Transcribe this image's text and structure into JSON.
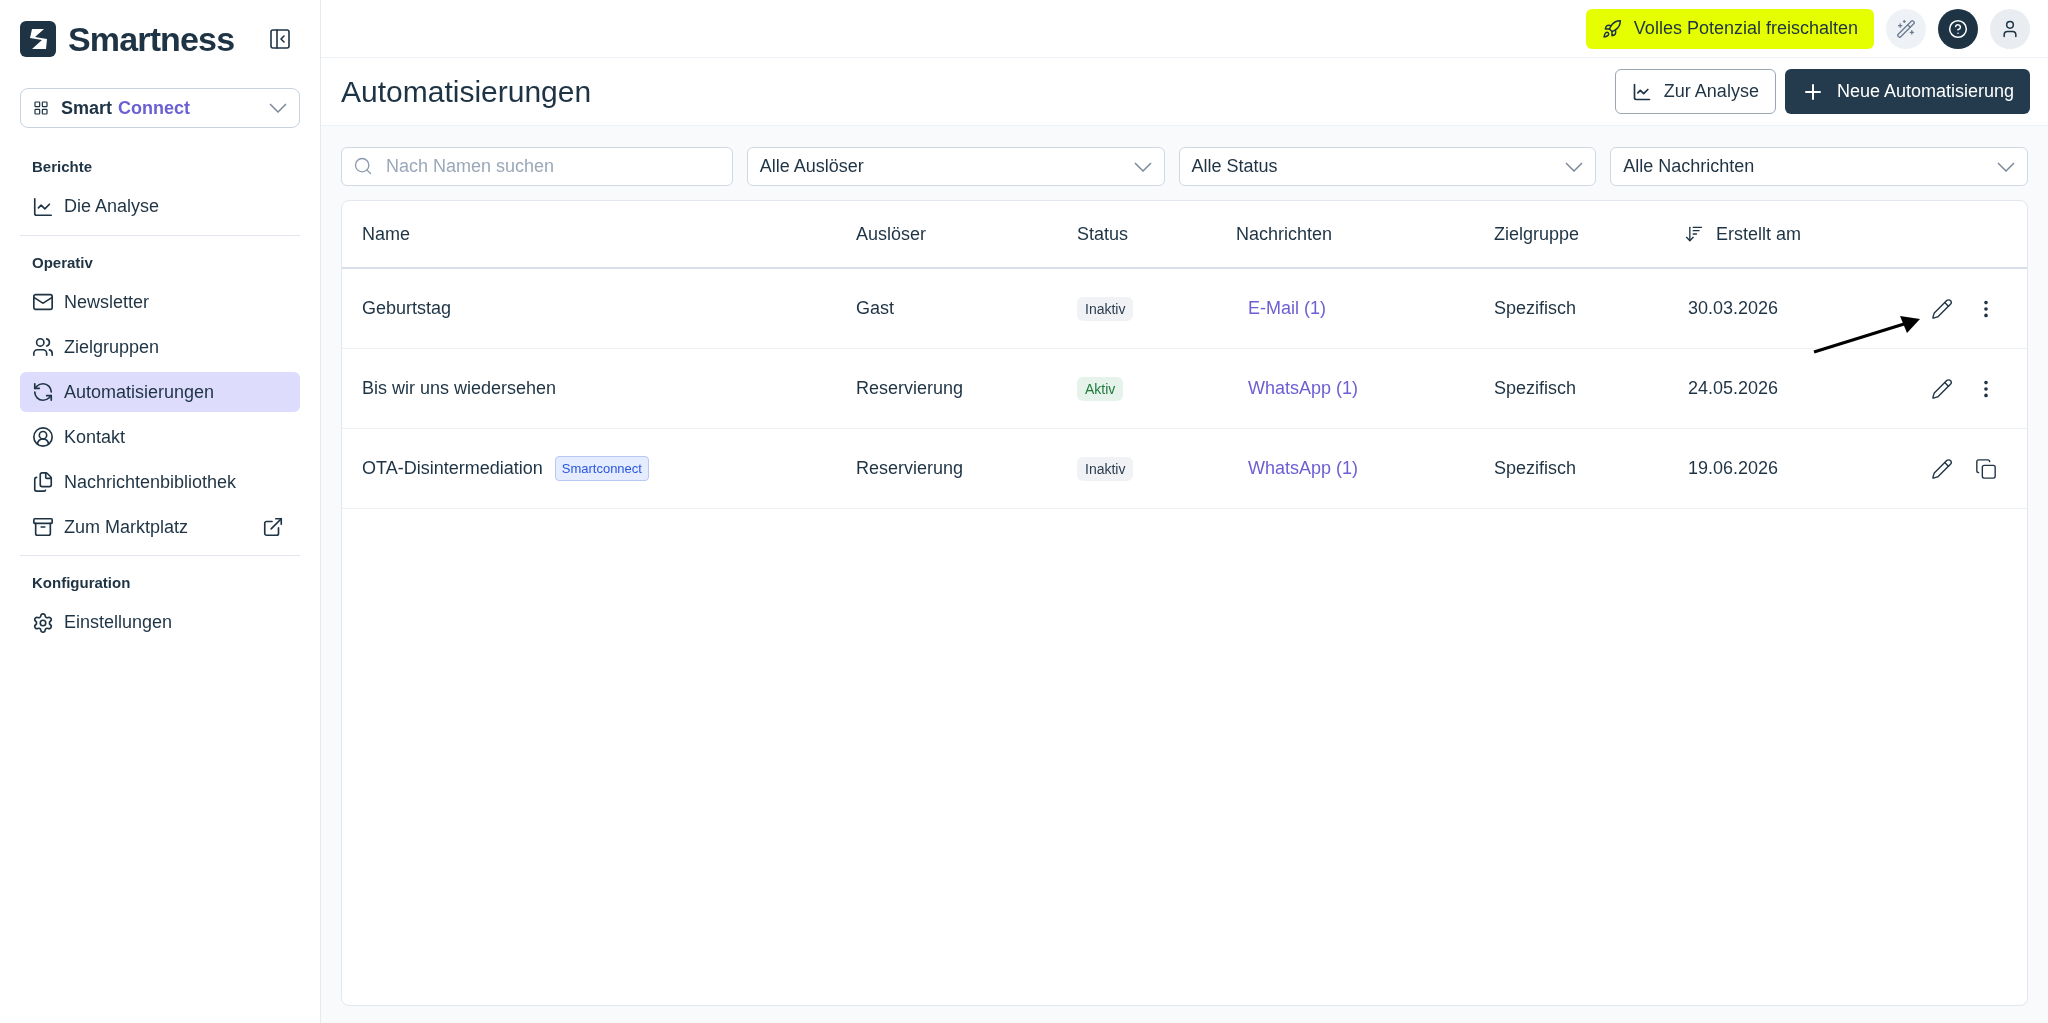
{
  "brand": {
    "name": "Smartness"
  },
  "product_switcher": {
    "label_bold": "Smart",
    "label_accent": "Connect"
  },
  "sidebar": {
    "sections": [
      {
        "title": "Berichte",
        "items": [
          {
            "label": "Die Analyse",
            "selected": false
          }
        ]
      },
      {
        "title": "Operativ",
        "items": [
          {
            "label": "Newsletter",
            "selected": false
          },
          {
            "label": "Zielgruppen",
            "selected": false
          },
          {
            "label": "Automatisierungen",
            "selected": true
          },
          {
            "label": "Kontakt",
            "selected": false
          },
          {
            "label": "Nachrichtenbibliothek",
            "selected": false
          },
          {
            "label": "Zum Marktplatz",
            "selected": false,
            "external": true
          }
        ]
      },
      {
        "title": "Konfiguration",
        "items": [
          {
            "label": "Einstellungen",
            "selected": false
          }
        ]
      }
    ]
  },
  "top_bar": {
    "upgrade_button": "Volles Potenzial freischalten"
  },
  "page": {
    "title": "Automatisierungen",
    "buttons": [
      {
        "label": "Zur Analyse",
        "kind": "secondary"
      },
      {
        "label": "Neue Automatisierung",
        "kind": "primary"
      }
    ]
  },
  "filters": {
    "search": {
      "placeholder": "Nach Namen suchen"
    },
    "selects": [
      "Alle Auslöser",
      "Alle Status",
      "Alle Nachrichten"
    ]
  },
  "table": {
    "columns": [
      "Name",
      "Auslöser",
      "Status",
      "Nachrichten",
      "Zielgruppe",
      "Erstellt am"
    ],
    "rows": [
      {
        "name": "Geburtstag",
        "trigger": "Gast",
        "status": "Inaktiv",
        "active": false,
        "messages": "E-Mail (1)",
        "audience": "Spezifisch",
        "created": "30.03.2026",
        "kind": "menu"
      },
      {
        "name": "Bis wir uns wiedersehen",
        "trigger": "Reservierung",
        "status": "Aktiv",
        "active": true,
        "messages": "WhatsApp (1)",
        "audience": "Spezifisch",
        "created": "24.05.2026",
        "kind": "menu"
      },
      {
        "name": "OTA-Disintermediation",
        "tag": "Smartconnect",
        "trigger": "Reservierung",
        "status": "Inaktiv",
        "active": false,
        "messages": "WhatsApp (1)",
        "audience": "Spezifisch",
        "created": "19.06.2026",
        "kind": "copy"
      }
    ]
  }
}
